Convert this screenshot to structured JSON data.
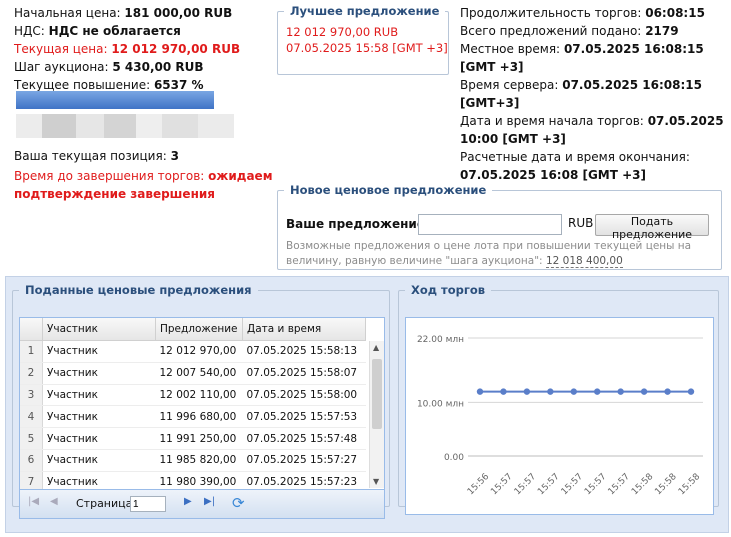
{
  "left": {
    "start_price_label": "Начальная цена:",
    "start_price": "181 000,00 RUB",
    "vat_label": "НДС:",
    "vat": "НДС не облагается",
    "current_price_label": "Текущая цена:",
    "current_price": "12 012 970,00 RUB",
    "step_label": "Шаг аукциона:",
    "step": "5 430,00 RUB",
    "increase_label": "Текущее повышение:",
    "increase": "6537 %",
    "position_label": "Ваша текущая позиция:",
    "position": "3",
    "remaining_label": "Время до завершения торгов:",
    "remaining": "ожидаем подтверждение завершения"
  },
  "best_offer": {
    "legend": "Лучшее предложение",
    "amount": "12 012 970,00 RUB",
    "datetime": "07.05.2025 15:58 [GMT +3]"
  },
  "right": {
    "duration_label": "Продолжительность торгов:",
    "duration": "06:08:15",
    "total_label": "Всего предложений подано:",
    "total": "2179",
    "local_label": "Местное время:",
    "local": "07.05.2025 16:08:15 [GMT +3]",
    "server_label": "Время сервера:",
    "server": "07.05.2025 16:08:15 [GMT+3]",
    "start_label": "Дата и время начала торгов:",
    "start": "07.05.2025 10:00 [GMT +3]",
    "end_label": "Расчетные дата и время окончания:",
    "end": "07.05.2025 16:08 [GMT +3]"
  },
  "new_offer": {
    "legend": "Новое ценовое предложение",
    "label": "Ваше предложение:",
    "input_value": "",
    "currency": "RUB",
    "submit": "Подать предложение",
    "hint": "Возможные предложения о цене лота при повышении текущей цены на величину, равную величине \"шага аукциона\":",
    "hint_amount": "12 018 400,00"
  },
  "bids": {
    "legend": "Поданные ценовые предложения",
    "columns": [
      "Участник",
      "Предложение",
      "Дата и время"
    ],
    "rows": [
      {
        "n": "1",
        "participant": "Участник",
        "offer": "12 012 970,00",
        "time": "07.05.2025 15:58:13"
      },
      {
        "n": "2",
        "participant": "Участник",
        "offer": "12 007 540,00",
        "time": "07.05.2025 15:58:07"
      },
      {
        "n": "3",
        "participant": "Участник",
        "offer": "12 002 110,00",
        "time": "07.05.2025 15:58:00"
      },
      {
        "n": "4",
        "participant": "Участник",
        "offer": "11 996 680,00",
        "time": "07.05.2025 15:57:53"
      },
      {
        "n": "5",
        "participant": "Участник",
        "offer": "11 991 250,00",
        "time": "07.05.2025 15:57:48"
      },
      {
        "n": "6",
        "participant": "Участник",
        "offer": "11 985 820,00",
        "time": "07.05.2025 15:57:27"
      },
      {
        "n": "7",
        "participant": "Участник",
        "offer": "11 980 390,00",
        "time": "07.05.2025 15:57:23"
      }
    ],
    "pager_label": "Страница",
    "page": "1"
  },
  "progress": {
    "legend": "Ход торгов"
  },
  "chart_data": {
    "type": "line",
    "title": "",
    "xlabel": "",
    "ylabel": "",
    "ylim": [
      0,
      22
    ],
    "y_ticks": [
      "0.00",
      "10.00 млн",
      "22.00 млн"
    ],
    "y_tick_values": [
      0,
      10,
      22
    ],
    "x": [
      "15:56",
      "15:57",
      "15:57",
      "15:57",
      "15:57",
      "15:57",
      "15:57",
      "15:58",
      "15:58",
      "15:58"
    ],
    "series": [
      {
        "values": [
          12.0,
          12.0,
          12.0,
          12.0,
          12.0,
          12.0,
          12.0,
          12.0,
          12.0,
          12.0
        ]
      }
    ],
    "grid": true,
    "colors": {
      "line": "#5a7ec9"
    }
  }
}
